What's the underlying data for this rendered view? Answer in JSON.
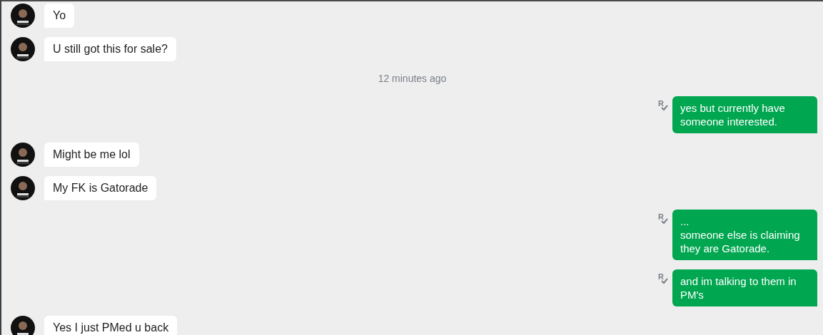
{
  "messages": [
    {
      "kind": "incoming",
      "text": "Yo"
    },
    {
      "kind": "incoming",
      "text": "U still got this for sale?"
    },
    {
      "kind": "timestamp",
      "text": "12 minutes ago"
    },
    {
      "kind": "outgoing",
      "text": "yes but currently have someone interested.",
      "receipt": "R"
    },
    {
      "kind": "incoming",
      "text": "Might be me lol"
    },
    {
      "kind": "incoming",
      "text": "My FK is Gatorade"
    },
    {
      "kind": "outgoing",
      "text": "...\nsomeone else is claiming they are Gatorade.",
      "receipt": "R"
    },
    {
      "kind": "outgoing",
      "text": "and im talking to them in PM's",
      "receipt": "R"
    },
    {
      "kind": "incoming",
      "text": "Yes I just PMed u back"
    }
  ]
}
